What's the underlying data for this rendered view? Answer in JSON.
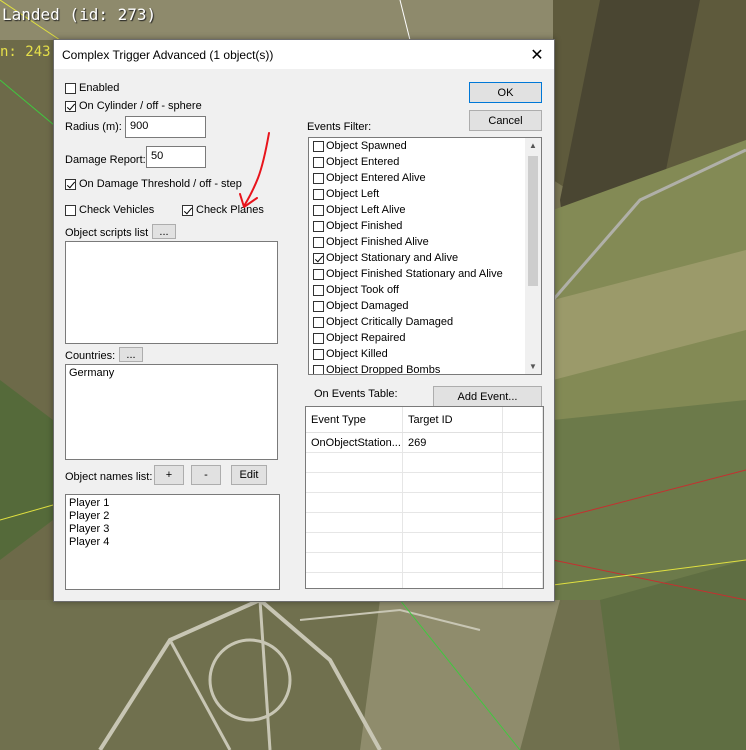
{
  "overlay": {
    "landed_label": "Landed (id: 273)",
    "side_label": "n: 243"
  },
  "dialog": {
    "title": "Complex Trigger Advanced (1 object(s))",
    "close_glyph": "✕",
    "enabled_label": "Enabled",
    "enabled_checked": false,
    "cylinder_label": "On Cylinder / off - sphere",
    "cylinder_checked": true,
    "radius_label": "Radius (m):",
    "radius_value": "900",
    "damage_report_label": "Damage Report:",
    "damage_report_value": "50",
    "damage_threshold_label": "On Damage Threshold / off - step",
    "damage_threshold_checked": true,
    "check_vehicles_label": "Check Vehicles",
    "check_vehicles_checked": false,
    "check_planes_label": "Check Planes",
    "check_planes_checked": true,
    "scripts_label": "Object scripts list",
    "browse_label": "...",
    "countries_label": "Countries:",
    "countries": [
      "Germany"
    ],
    "object_names_label": "Object names list:",
    "plus_label": "+",
    "minus_label": "-",
    "edit_label": "Edit",
    "object_names": [
      "Player 1",
      "Player 2",
      "Player 3",
      "Player 4"
    ],
    "ok_label": "OK",
    "cancel_label": "Cancel",
    "events_filter_label": "Events Filter:",
    "events_filter": [
      {
        "label": "Object Spawned",
        "checked": false
      },
      {
        "label": "Object Entered",
        "checked": false
      },
      {
        "label": "Object Entered Alive",
        "checked": false
      },
      {
        "label": "Object Left",
        "checked": false
      },
      {
        "label": "Object Left Alive",
        "checked": false
      },
      {
        "label": "Object Finished",
        "checked": false
      },
      {
        "label": "Object Finished Alive",
        "checked": false
      },
      {
        "label": "Object Stationary and Alive",
        "checked": true
      },
      {
        "label": "Object Finished Stationary and Alive",
        "checked": false
      },
      {
        "label": "Object Took off",
        "checked": false
      },
      {
        "label": "Object Damaged",
        "checked": false
      },
      {
        "label": "Object Critically Damaged",
        "checked": false
      },
      {
        "label": "Object Repaired",
        "checked": false
      },
      {
        "label": "Object Killed",
        "checked": false
      },
      {
        "label": "Object Dropped Bombs",
        "checked": false
      }
    ],
    "on_events_table_label": "On Events Table:",
    "add_event_label": "Add Event...",
    "events_table": {
      "columns": [
        "Event Type",
        "Target ID"
      ],
      "rows": [
        [
          "OnObjectStation...",
          "269"
        ]
      ]
    }
  },
  "colors": {
    "annotation_arrow": "#e8141c",
    "accent_border": "#0078d7"
  }
}
